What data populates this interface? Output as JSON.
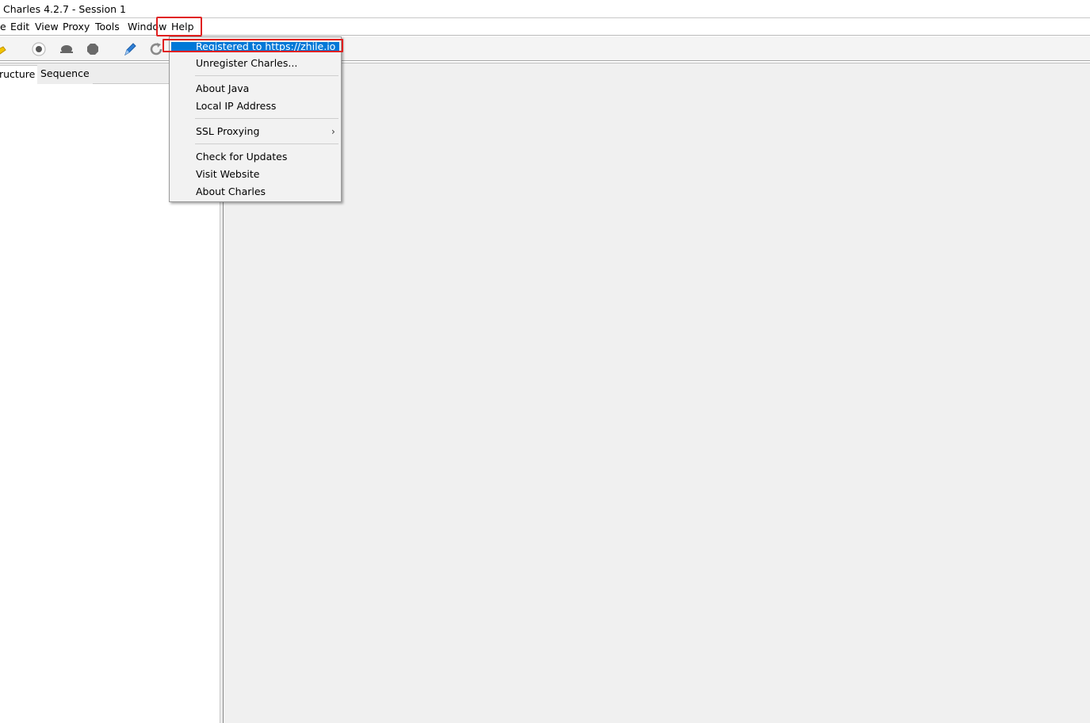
{
  "window": {
    "title": "Charles 4.2.7 - Session 1"
  },
  "menubar": {
    "items": [
      {
        "label": "e"
      },
      {
        "label": "Edit"
      },
      {
        "label": "View"
      },
      {
        "label": "Proxy"
      },
      {
        "label": "Tools"
      },
      {
        "label": "Window"
      },
      {
        "label": "Help"
      }
    ]
  },
  "toolbar": {
    "icons": [
      "broom-icon",
      "record-icon",
      "throttle-turtle-icon",
      "breakpoint-stop-icon",
      "compose-pen-icon",
      "refresh-icon"
    ]
  },
  "left_panel": {
    "tabs": [
      {
        "label": "ructure",
        "active": true
      },
      {
        "label": "Sequence",
        "active": false
      }
    ]
  },
  "help_menu": {
    "items": [
      {
        "label": "Registered to https://zhile.io",
        "selected": true
      },
      {
        "label": "Unregister Charles..."
      },
      {
        "label": "About Java"
      },
      {
        "label": "Local IP Address"
      },
      {
        "label": "SSL Proxying",
        "submenu": true
      },
      {
        "label": "Check for Updates"
      },
      {
        "label": "Visit Website"
      },
      {
        "label": "About Charles"
      }
    ],
    "submenu_arrow": "›"
  },
  "colors": {
    "selection": "#0078d7",
    "highlight_box": "#e02020",
    "menu_bg": "#f2f2f2",
    "content_bg": "#f0f0f0"
  }
}
